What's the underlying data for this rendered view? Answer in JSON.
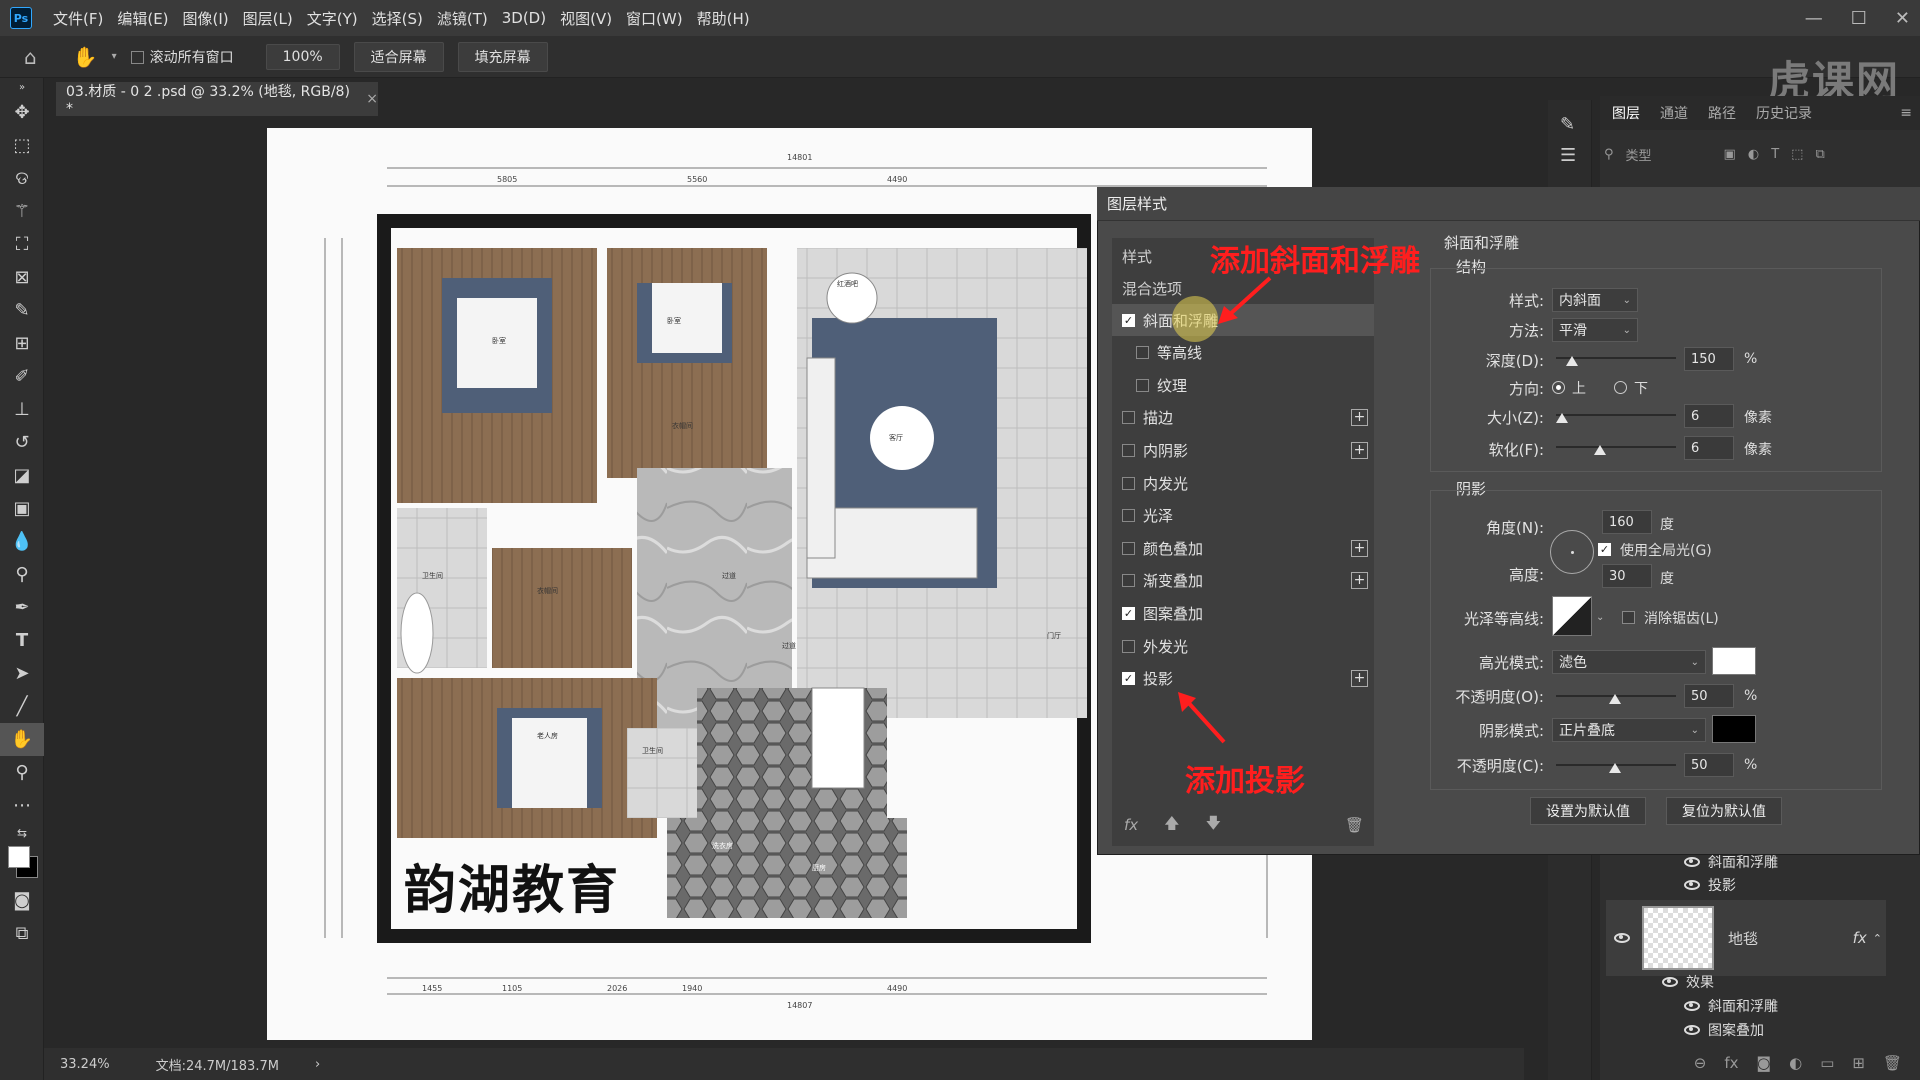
{
  "menubar": {
    "logo": "Ps",
    "items": [
      "文件(F)",
      "编辑(E)",
      "图像(I)",
      "图层(L)",
      "文字(Y)",
      "选择(S)",
      "滤镜(T)",
      "3D(D)",
      "视图(V)",
      "窗口(W)",
      "帮助(H)"
    ],
    "watermark": "虎课网"
  },
  "options": {
    "scroll_all": "滚动所有窗口",
    "zoom": "100%",
    "fit_screen": "适合屏幕",
    "fill_screen": "填充屏幕"
  },
  "document": {
    "tab_title": "03.材质 - 0 2 .psd @ 33.2% (地毯, RGB/8) *",
    "brand_text": "韵湖教育",
    "room_labels": [
      "卧室",
      "卧室",
      "衣帽间",
      "卫生间",
      "衣帽间",
      "过道",
      "客厅",
      "红酒吧",
      "过道",
      "餐厅",
      "老人房",
      "卫生间",
      "洗衣房",
      "厨房",
      "门厅"
    ],
    "dimensions_top": [
      "14801",
      "5805",
      "5560",
      "4490"
    ],
    "dimensions_bottom": [
      "14807",
      "1455",
      "1105",
      "2026",
      "1940",
      "4490"
    ]
  },
  "status": {
    "zoom": "33.24%",
    "doc_size": "文档:24.7M/183.7M"
  },
  "layers_panel": {
    "tabs": [
      "图层",
      "通道",
      "路径",
      "历史记录"
    ],
    "filter_placeholder": "类型",
    "upper_effects": [
      "斜面和浮雕",
      "投影"
    ],
    "layer_name": "地毯",
    "fx_label": "fx",
    "effects_label": "效果",
    "lower_effects": [
      "斜面和浮雕",
      "图案叠加"
    ]
  },
  "dialog": {
    "title": "图层样式",
    "styles_header": "样式",
    "blend_options": "混合选项",
    "styles": [
      {
        "label": "斜面和浮雕",
        "checked": true,
        "plus": false,
        "sub": false
      },
      {
        "label": "等高线",
        "checked": false,
        "plus": false,
        "sub": true
      },
      {
        "label": "纹理",
        "checked": false,
        "plus": false,
        "sub": true
      },
      {
        "label": "描边",
        "checked": false,
        "plus": true,
        "sub": false
      },
      {
        "label": "内阴影",
        "checked": false,
        "plus": true,
        "sub": false
      },
      {
        "label": "内发光",
        "checked": false,
        "plus": false,
        "sub": false
      },
      {
        "label": "光泽",
        "checked": false,
        "plus": false,
        "sub": false
      },
      {
        "label": "颜色叠加",
        "checked": false,
        "plus": true,
        "sub": false
      },
      {
        "label": "渐变叠加",
        "checked": false,
        "plus": true,
        "sub": false
      },
      {
        "label": "图案叠加",
        "checked": true,
        "plus": false,
        "sub": false
      },
      {
        "label": "外发光",
        "checked": false,
        "plus": false,
        "sub": false
      },
      {
        "label": "投影",
        "checked": true,
        "plus": true,
        "sub": false
      }
    ],
    "footer_fx": "fx",
    "bevel": {
      "title": "斜面和浮雕",
      "structure": "结构",
      "style_label": "样式:",
      "style_value": "内斜面",
      "technique_label": "方法:",
      "technique_value": "平滑",
      "depth_label": "深度(D):",
      "depth_value": "150",
      "depth_unit": "%",
      "direction_label": "方向:",
      "dir_up": "上",
      "dir_down": "下",
      "size_label": "大小(Z):",
      "size_value": "6",
      "size_unit": "像素",
      "soften_label": "软化(F):",
      "soften_value": "6",
      "soften_unit": "像素"
    },
    "shading": {
      "title": "阴影",
      "angle_label": "角度(N):",
      "angle_value": "160",
      "angle_unit": "度",
      "global_light": "使用全局光(G)",
      "altitude_label": "高度:",
      "altitude_value": "30",
      "altitude_unit": "度",
      "gloss_label": "光泽等高线:",
      "anti_alias": "消除锯齿(L)",
      "highlight_label": "高光模式:",
      "highlight_value": "滤色",
      "highlight_color": "#ffffff",
      "hl_opacity_label": "不透明度(O):",
      "hl_opacity_value": "50",
      "hl_opacity_unit": "%",
      "shadow_label": "阴影模式:",
      "shadow_value": "正片叠底",
      "shadow_color": "#000000",
      "sh_opacity_label": "不透明度(C):",
      "sh_opacity_value": "50",
      "sh_opacity_unit": "%"
    },
    "btn_default": "设置为默认值",
    "btn_reset": "复位为默认值"
  },
  "annotations": {
    "add_bevel": "添加斜面和浮雕",
    "add_shadow": "添加投影"
  }
}
